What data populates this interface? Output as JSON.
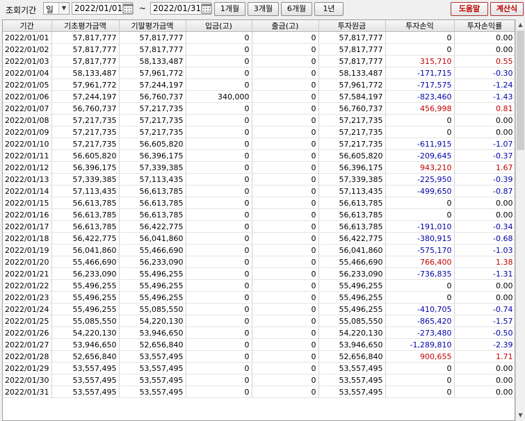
{
  "toolbar": {
    "label": "조회기간",
    "period_unit": "일",
    "start_date": "2022/01/01",
    "tilde": "~",
    "end_date": "2022/01/31",
    "btn_1m": "1개월",
    "btn_3m": "3개월",
    "btn_6m": "6개월",
    "btn_1y": "1년",
    "help": "도움말",
    "calculator": "계산식"
  },
  "table": {
    "columns": [
      "기간",
      "기초평가금액",
      "기말평가금액",
      "입금(고)",
      "출금(고)",
      "투자원금",
      "투자손익",
      "투자손익률"
    ],
    "rows": [
      [
        "2022/01/01",
        "57,817,777",
        "57,817,777",
        "0",
        "0",
        "57,817,777",
        "0",
        "0.00"
      ],
      [
        "2022/01/02",
        "57,817,777",
        "57,817,777",
        "0",
        "0",
        "57,817,777",
        "0",
        "0.00"
      ],
      [
        "2022/01/03",
        "57,817,777",
        "58,133,487",
        "0",
        "0",
        "57,817,777",
        "315,710",
        "0.55"
      ],
      [
        "2022/01/04",
        "58,133,487",
        "57,961,772",
        "0",
        "0",
        "58,133,487",
        "-171,715",
        "-0.30"
      ],
      [
        "2022/01/05",
        "57,961,772",
        "57,244,197",
        "0",
        "0",
        "57,961,772",
        "-717,575",
        "-1.24"
      ],
      [
        "2022/01/06",
        "57,244,197",
        "56,760,737",
        "340,000",
        "0",
        "57,584,197",
        "-823,460",
        "-1.43"
      ],
      [
        "2022/01/07",
        "56,760,737",
        "57,217,735",
        "0",
        "0",
        "56,760,737",
        "456,998",
        "0.81"
      ],
      [
        "2022/01/08",
        "57,217,735",
        "57,217,735",
        "0",
        "0",
        "57,217,735",
        "0",
        "0.00"
      ],
      [
        "2022/01/09",
        "57,217,735",
        "57,217,735",
        "0",
        "0",
        "57,217,735",
        "0",
        "0.00"
      ],
      [
        "2022/01/10",
        "57,217,735",
        "56,605,820",
        "0",
        "0",
        "57,217,735",
        "-611,915",
        "-1.07"
      ],
      [
        "2022/01/11",
        "56,605,820",
        "56,396,175",
        "0",
        "0",
        "56,605,820",
        "-209,645",
        "-0.37"
      ],
      [
        "2022/01/12",
        "56,396,175",
        "57,339,385",
        "0",
        "0",
        "56,396,175",
        "943,210",
        "1.67"
      ],
      [
        "2022/01/13",
        "57,339,385",
        "57,113,435",
        "0",
        "0",
        "57,339,385",
        "-225,950",
        "-0.39"
      ],
      [
        "2022/01/14",
        "57,113,435",
        "56,613,785",
        "0",
        "0",
        "57,113,435",
        "-499,650",
        "-0.87"
      ],
      [
        "2022/01/15",
        "56,613,785",
        "56,613,785",
        "0",
        "0",
        "56,613,785",
        "0",
        "0.00"
      ],
      [
        "2022/01/16",
        "56,613,785",
        "56,613,785",
        "0",
        "0",
        "56,613,785",
        "0",
        "0.00"
      ],
      [
        "2022/01/17",
        "56,613,785",
        "56,422,775",
        "0",
        "0",
        "56,613,785",
        "-191,010",
        "-0.34"
      ],
      [
        "2022/01/18",
        "56,422,775",
        "56,041,860",
        "0",
        "0",
        "56,422,775",
        "-380,915",
        "-0.68"
      ],
      [
        "2022/01/19",
        "56,041,860",
        "55,466,690",
        "0",
        "0",
        "56,041,860",
        "-575,170",
        "-1.03"
      ],
      [
        "2022/01/20",
        "55,466,690",
        "56,233,090",
        "0",
        "0",
        "55,466,690",
        "766,400",
        "1.38"
      ],
      [
        "2022/01/21",
        "56,233,090",
        "55,496,255",
        "0",
        "0",
        "56,233,090",
        "-736,835",
        "-1.31"
      ],
      [
        "2022/01/22",
        "55,496,255",
        "55,496,255",
        "0",
        "0",
        "55,496,255",
        "0",
        "0.00"
      ],
      [
        "2022/01/23",
        "55,496,255",
        "55,496,255",
        "0",
        "0",
        "55,496,255",
        "0",
        "0.00"
      ],
      [
        "2022/01/24",
        "55,496,255",
        "55,085,550",
        "0",
        "0",
        "55,496,255",
        "-410,705",
        "-0.74"
      ],
      [
        "2022/01/25",
        "55,085,550",
        "54,220,130",
        "0",
        "0",
        "55,085,550",
        "-865,420",
        "-1.57"
      ],
      [
        "2022/01/26",
        "54,220,130",
        "53,946,650",
        "0",
        "0",
        "54,220,130",
        "-273,480",
        "-0.50"
      ],
      [
        "2022/01/27",
        "53,946,650",
        "52,656,840",
        "0",
        "0",
        "53,946,650",
        "-1,289,810",
        "-2.39"
      ],
      [
        "2022/01/28",
        "52,656,840",
        "53,557,495",
        "0",
        "0",
        "52,656,840",
        "900,655",
        "1.71"
      ],
      [
        "2022/01/29",
        "53,557,495",
        "53,557,495",
        "0",
        "0",
        "53,557,495",
        "0",
        "0.00"
      ],
      [
        "2022/01/30",
        "53,557,495",
        "53,557,495",
        "0",
        "0",
        "53,557,495",
        "0",
        "0.00"
      ],
      [
        "2022/01/31",
        "53,557,495",
        "53,557,495",
        "0",
        "0",
        "53,557,495",
        "0",
        "0.00"
      ]
    ]
  },
  "colors": {
    "positive": "#c00000",
    "negative": "#0000a8"
  }
}
